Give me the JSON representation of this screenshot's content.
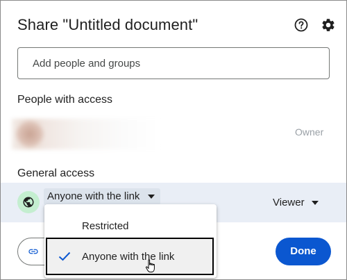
{
  "dialog": {
    "title": "Share \"Untitled document\"",
    "help_icon": "help-circle-icon",
    "settings_icon": "gear-icon"
  },
  "add_people": {
    "placeholder": "Add people and groups"
  },
  "people_section": {
    "heading": "People with access",
    "owner_role": "Owner"
  },
  "general_access": {
    "heading": "General access",
    "selected": "Anyone with the link",
    "role": "Viewer",
    "icon": "globe-icon",
    "options": [
      {
        "label": "Restricted",
        "checked": false
      },
      {
        "label": "Anyone with the link",
        "checked": true
      }
    ]
  },
  "footer": {
    "copy_link_icon": "link-icon",
    "done_label": "Done"
  },
  "colors": {
    "accent": "#0b57d0",
    "row_highlight": "#e9eef6",
    "globe_bg": "#c4eed0"
  }
}
